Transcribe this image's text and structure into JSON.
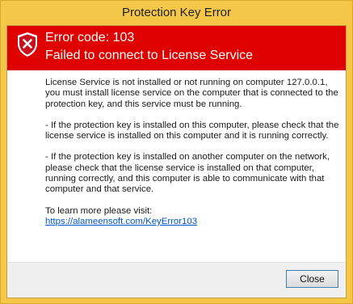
{
  "window": {
    "title": "Protection Key Error"
  },
  "header": {
    "error_code": "Error code: 103",
    "message": "Failed to connect to License Service",
    "icon": "shield-error-icon",
    "background_color": "#df0000"
  },
  "body": {
    "paragraph1": "License Service is not installed or not running on computer 127.0.0.1, you must install license service on the computer that is connected to the protection key, and this service must be running.",
    "paragraph2": "- If the protection key is installed on this computer, please check that the license service is installed on this computer and it is running correctly.",
    "paragraph3": "- If the protection key is installed on another computer on the network, please check that the license service is installed on that computer, running correctly, and this computer is able to communicate with that computer and that service.",
    "learn_more": "To learn more please visit:",
    "link_text": "https://alameensoft.com/KeyError103"
  },
  "footer": {
    "close_label": "Close"
  }
}
